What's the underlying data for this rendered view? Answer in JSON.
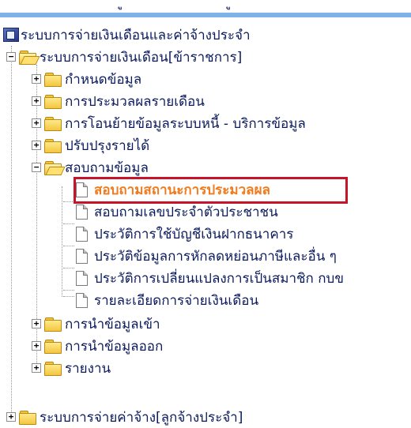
{
  "top_fragments": [
    "ู",
    "ู"
  ],
  "tree": {
    "root_label": "ระบบการจ่ายเงินเดือนและค่าจ้างประจำ",
    "system1": {
      "label": "ระบบการจ่ายเงินเดือน[ข้าราชการ]",
      "expander": "−",
      "folders": [
        {
          "label": "กำหนดข้อมูล",
          "expander": "+"
        },
        {
          "label": "การประมวลผลรายเดือน",
          "expander": "+"
        },
        {
          "label": "การโอนย้ายข้อมูลระบบหนี้ - บริการข้อมูล",
          "expander": "+"
        },
        {
          "label": "ปรับปรุงรายได้",
          "expander": "+"
        }
      ],
      "inquiry": {
        "label": "สอบถามข้อมูล",
        "expander": "−",
        "items": [
          {
            "label": "สอบถามสถานะการประมวลผล",
            "selected": true
          },
          {
            "label": "สอบถามเลขประจำตัวประชาชน",
            "selected": false
          },
          {
            "label": "ประวัติการใช้บัญชีเงินฝากธนาคาร",
            "selected": false
          },
          {
            "label": "ประวัติข้อมูลการหักลดหย่อนภาษีและอื่น ๆ",
            "selected": false
          },
          {
            "label": "ประวัติการเปลี่ยนแปลงการเป็นสมาชิก กบข",
            "selected": false
          },
          {
            "label": "รายละเอียดการจ่ายเงินเดือน",
            "selected": false
          }
        ]
      },
      "folders_after": [
        {
          "label": "การนำข้อมูลเข้า",
          "expander": "+"
        },
        {
          "label": "การนำข้อมูลออก",
          "expander": "+"
        },
        {
          "label": "รายงาน",
          "expander": "+"
        }
      ]
    },
    "system2": {
      "label": "ระบบการจ่ายค่าจ้าง[ลูกจ้างประจำ]",
      "expander": "+"
    }
  },
  "colors": {
    "text": "#0a1a5c",
    "selected_text": "#f07b1f",
    "highlight_border": "#c8142a",
    "folder": "#f3c640",
    "top_strip": "#7fb2e6"
  }
}
